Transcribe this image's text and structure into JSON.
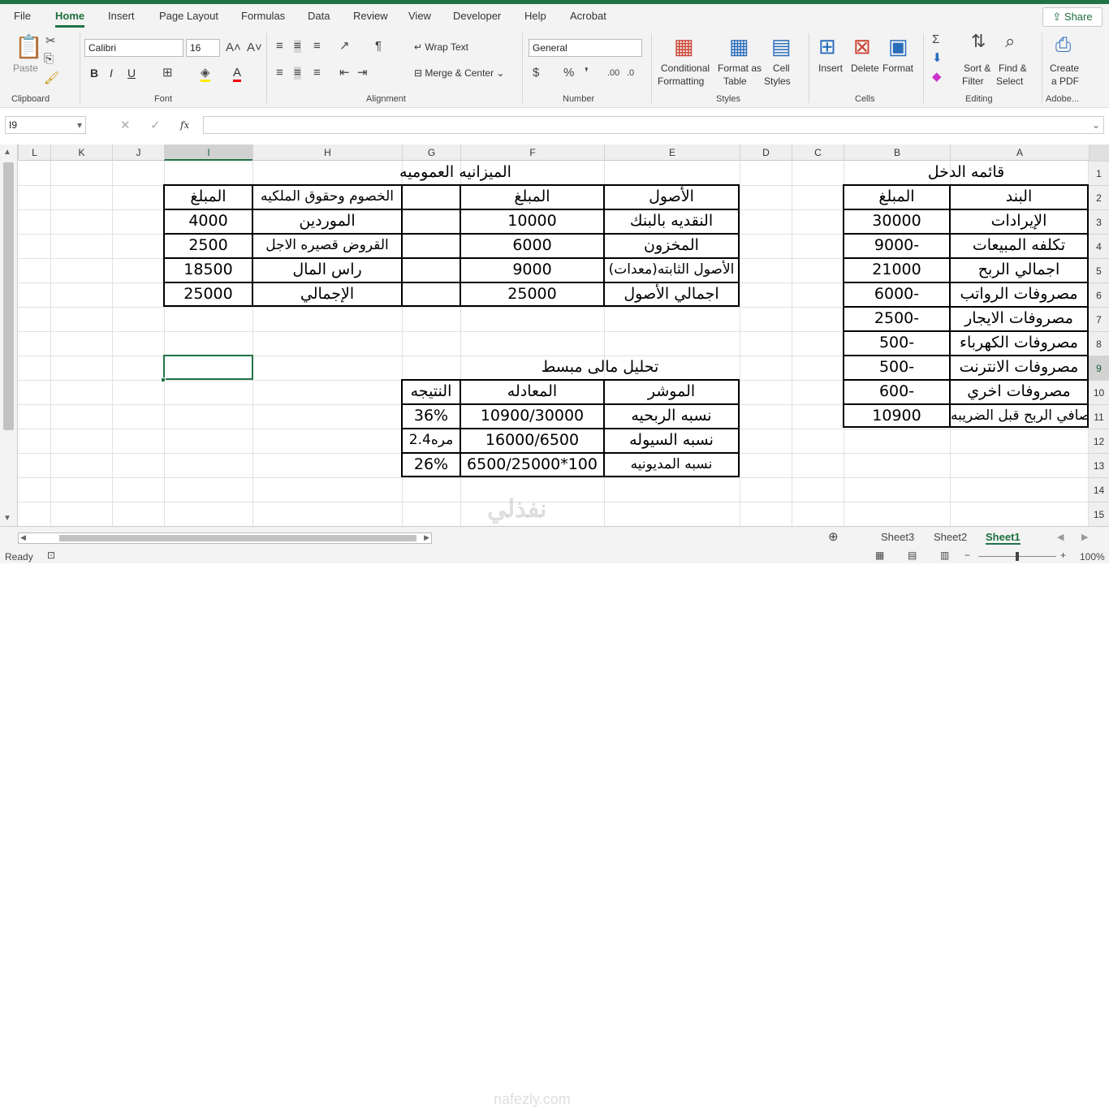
{
  "menu": {
    "tabs": [
      "File",
      "Home",
      "Insert",
      "Page Layout",
      "Formulas",
      "Data",
      "Review",
      "View",
      "Developer",
      "Help",
      "Acrobat"
    ],
    "share": "Share"
  },
  "ribbon": {
    "clipboard": {
      "paste": "Paste",
      "group": "Clipboard"
    },
    "font": {
      "name": "Calibri",
      "size": "16",
      "group": "Font",
      "bold": "B",
      "italic": "I",
      "underline": "U"
    },
    "alignment": {
      "wrap": "Wrap Text",
      "merge": "Merge & Center",
      "group": "Alignment"
    },
    "number": {
      "format": "General",
      "group": "Number"
    },
    "styles": {
      "cond1": "Conditional",
      "cond2": "Formatting",
      "fmt1": "Format as",
      "fmt2": "Table",
      "cell1": "Cell",
      "cell2": "Styles",
      "group": "Styles"
    },
    "cells": {
      "insert": "Insert",
      "delete": "Delete",
      "format": "Format",
      "group": "Cells"
    },
    "editing": {
      "sort1": "Sort &",
      "sort2": "Filter",
      "find1": "Find &",
      "find2": "Select",
      "group": "Editing"
    },
    "adobe": {
      "c1": "Create",
      "c2": "a PDF",
      "group": "Adobe..."
    }
  },
  "formula_bar": {
    "name_box": "I9",
    "fx": "fx",
    "formula": ""
  },
  "columns": [
    "L",
    "K",
    "J",
    "I",
    "H",
    "G",
    "F",
    "E",
    "D",
    "C",
    "B",
    "A"
  ],
  "rows": [
    "1",
    "2",
    "3",
    "4",
    "5",
    "6",
    "7",
    "8",
    "9",
    "10",
    "11",
    "12",
    "13",
    "14",
    "15"
  ],
  "income": {
    "title": "قائمه الدخل",
    "headers": [
      "البند",
      "المبلغ"
    ],
    "rows": [
      [
        "الإيرادات",
        "30000"
      ],
      [
        "تكلفه المبيعات",
        "9000-"
      ],
      [
        "اجمالي الربح",
        "21000"
      ],
      [
        "مصروفات الرواتب",
        "6000-"
      ],
      [
        "مصروفات الايجار",
        "2500-"
      ],
      [
        "مصروفات الكهرباء",
        "500-"
      ],
      [
        "مصروفات الانترنت",
        "500-"
      ],
      [
        "مصروفات اخري",
        "600-"
      ],
      [
        "صافي الربح قبل الضريبه",
        "10900"
      ]
    ]
  },
  "balance": {
    "title": "الميزانيه العموميه",
    "headers": [
      "الأصول",
      "المبلغ",
      "",
      "الخصوم وحقوق الملكيه",
      "المبلغ"
    ],
    "rows": [
      [
        "النقديه بالبنك",
        "10000",
        "",
        "الموردين",
        "4000"
      ],
      [
        "المخزون",
        "6000",
        "",
        "القروض قصيره الاجل",
        "2500"
      ],
      [
        "الأصول الثابته(معدات)",
        "9000",
        "",
        "راس المال",
        "18500"
      ],
      [
        "اجمالي الأصول",
        "25000",
        "",
        "الإجمالي",
        "25000"
      ]
    ]
  },
  "analysis": {
    "title": "تحليل مالى مبسط",
    "headers": [
      "الموشر",
      "المعادله",
      "النتيجه"
    ],
    "rows": [
      [
        "نسبه الربحيه",
        "10900/30000",
        "36%"
      ],
      [
        "نسبه السيوله",
        "16000/6500",
        "2.4مره"
      ],
      [
        "نسبه المديونيه",
        "6500/25000*100",
        "26%"
      ]
    ]
  },
  "sheets": [
    "Sheet3",
    "Sheet2",
    "Sheet1"
  ],
  "status": {
    "ready": "Ready",
    "zoom": "100%"
  },
  "watermark": {
    "text": "نفذلي",
    "url": "nafezly.com"
  }
}
